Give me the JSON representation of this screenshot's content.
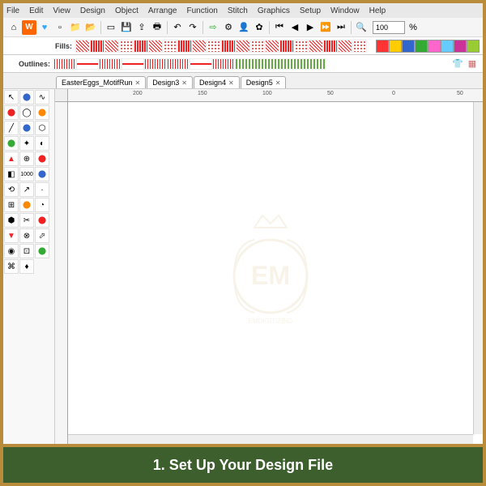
{
  "menu": [
    "File",
    "Edit",
    "View",
    "Design",
    "Object",
    "Arrange",
    "Function",
    "Stitch",
    "Graphics",
    "Setup",
    "Window",
    "Help"
  ],
  "toolbar": {
    "zoom_value": "100",
    "zoom_suffix": "%"
  },
  "fills": {
    "label": "Fills:"
  },
  "outlines": {
    "label": "Outlines:"
  },
  "tabs": [
    {
      "label": "EasterEggs_MotifRun"
    },
    {
      "label": "Design3"
    },
    {
      "label": "Design4"
    },
    {
      "label": "Design5"
    }
  ],
  "ruler": {
    "h_marks": [
      {
        "v": "200",
        "px": 80
      },
      {
        "v": "150",
        "px": 160
      },
      {
        "v": "100",
        "px": 240
      },
      {
        "v": "50",
        "px": 320
      },
      {
        "v": "0",
        "px": 400
      },
      {
        "v": "50",
        "px": 480
      }
    ]
  },
  "watermark": {
    "initials": "EM",
    "sub": "EMDIGITIZING"
  },
  "caption": "1. Set Up Your Design File",
  "colors": {
    "accent": "#ff6600",
    "caption_bg": "#3d5f2e",
    "frame": "#b88c3a",
    "swatches": [
      "#ff3333",
      "#ffcc00",
      "#3366cc",
      "#33aa33",
      "#ff66cc",
      "#333333",
      "#996633",
      "#66ccff",
      "#cc66ff",
      "#99cc33"
    ]
  }
}
